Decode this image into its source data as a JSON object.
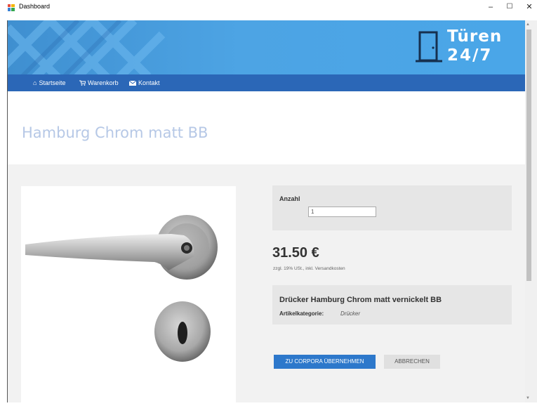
{
  "window": {
    "title": "Dashboard",
    "minimize": "–",
    "maximize": "☐",
    "close": "✕"
  },
  "logo": {
    "line1": "Türen",
    "line2": "24/7",
    "icon": "door-icon"
  },
  "nav": {
    "items": [
      {
        "label": "Startseite",
        "icon": "home-icon"
      },
      {
        "label": "Warenkorb",
        "icon": "cart-icon"
      },
      {
        "label": "Kontakt",
        "icon": "envelope-icon"
      }
    ]
  },
  "product": {
    "title": "Hamburg Chrom matt BB",
    "quantity_label": "Anzahl",
    "quantity_value": "1",
    "price": "31.50 €",
    "price_note": "zzgl. 19% USt., inkl. Versandkosten",
    "name": "Drücker Hamburg Chrom matt vernickelt BB",
    "category_label": "Artikelkategorie:",
    "category_value": "Drücker"
  },
  "actions": {
    "primary": "ZU CORPORA ÜBERNEHMEN",
    "secondary": "ABBRECHEN"
  },
  "colors": {
    "banner": "#4aa3e6",
    "navbar": "#2b67b7",
    "primary_button": "#2d78cb",
    "title_text": "#b6c8e6"
  }
}
